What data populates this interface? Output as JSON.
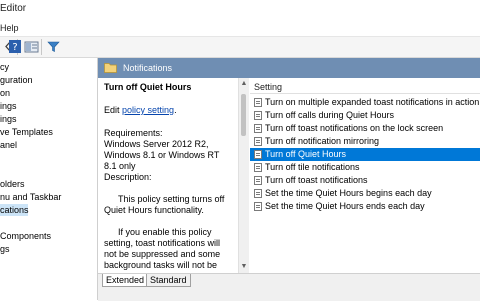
{
  "window": {
    "title": "Editor"
  },
  "menu": {
    "help_label": "Help"
  },
  "tree": {
    "items": [
      {
        "label": "cy",
        "selected": false
      },
      {
        "label": "guration",
        "selected": false
      },
      {
        "label": "on",
        "selected": false
      },
      {
        "label": "ings",
        "selected": false
      },
      {
        "label": "ings",
        "selected": false
      },
      {
        "label": "ve Templates",
        "selected": false
      },
      {
        "label": "anel",
        "selected": false
      },
      {
        "label": "",
        "selected": false
      },
      {
        "label": "olders",
        "selected": false
      },
      {
        "label": "nu and Taskbar",
        "selected": false
      },
      {
        "label": "cations",
        "selected": true
      },
      {
        "label": "",
        "selected": false
      },
      {
        "label": "Components",
        "selected": false
      },
      {
        "label": "gs",
        "selected": false
      }
    ]
  },
  "details": {
    "header_label": "Notifications",
    "policy_title": "Turn off Quiet Hours",
    "edit_prefix": "Edit",
    "edit_link": "policy setting",
    "edit_suffix": ".",
    "requirements_label": "Requirements:",
    "requirements_text": "Windows Server 2012 R2, Windows 8.1 or Windows RT 8.1 only",
    "description_label": "Description:",
    "description_p1": "This policy setting turns off Quiet Hours functionality.",
    "description_p2": "If you enable this policy setting, toast notifications will not be suppressed and some background tasks will not be"
  },
  "settings": {
    "column_header": "Setting",
    "rows": [
      {
        "label": "Turn on multiple expanded toast notifications in action center",
        "selected": false
      },
      {
        "label": "Turn off calls during Quiet Hours",
        "selected": false
      },
      {
        "label": "Turn off toast notifications on the lock screen",
        "selected": false
      },
      {
        "label": "Turn off notification mirroring",
        "selected": false
      },
      {
        "label": "Turn off Quiet Hours",
        "selected": true
      },
      {
        "label": "Turn off tile notifications",
        "selected": false
      },
      {
        "label": "Turn off toast notifications",
        "selected": false
      },
      {
        "label": "Set the time Quiet Hours begins each day",
        "selected": false
      },
      {
        "label": "Set the time Quiet Hours ends each day",
        "selected": false
      }
    ]
  },
  "tabs": [
    {
      "label": "Extended",
      "active": true
    },
    {
      "label": "Standard",
      "active": false
    }
  ],
  "colors": {
    "header_bg": "#6f8eb3",
    "selection": "#0078d7",
    "tree_selection": "#cce4f7"
  }
}
